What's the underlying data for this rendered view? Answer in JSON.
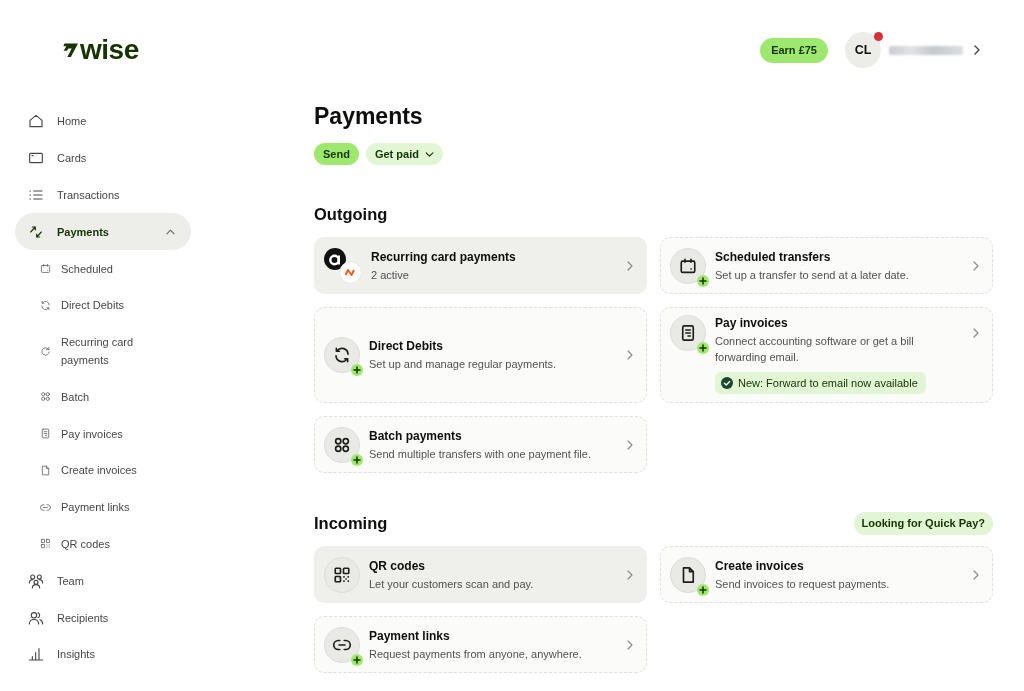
{
  "header": {
    "logo": "wise",
    "earn_button": "Earn £75",
    "account": {
      "initials": "CL",
      "notification": true
    }
  },
  "sidebar": {
    "items": [
      {
        "label": "Home",
        "selected": false
      },
      {
        "label": "Cards",
        "selected": false
      },
      {
        "label": "Transactions",
        "selected": false
      },
      {
        "label": "Payments",
        "selected": true,
        "expanded": true,
        "children": [
          {
            "label": "Scheduled",
            "selected": false
          },
          {
            "label": "Direct Debits",
            "selected": false
          },
          {
            "label": "Recurring card payments",
            "selected": false
          },
          {
            "label": "Batch",
            "selected": false
          },
          {
            "label": "Pay invoices",
            "selected": false
          },
          {
            "label": "Create invoices",
            "selected": false
          },
          {
            "label": "Payment links",
            "selected": false
          },
          {
            "label": "QR codes",
            "selected": false
          }
        ]
      },
      {
        "label": "Team",
        "selected": false
      },
      {
        "label": "Recipients",
        "selected": false
      },
      {
        "label": "Insights",
        "selected": false
      }
    ]
  },
  "page": {
    "title": "Payments",
    "tabs": [
      {
        "label": "Send",
        "selected": true,
        "kind": "button"
      },
      {
        "label": "Get paid",
        "selected": false,
        "kind": "dropdown"
      }
    ]
  },
  "sections": [
    {
      "title": "Outgoing",
      "cards": [
        {
          "kind": "active",
          "title": "Recurring card payments",
          "description": "2 active"
        },
        {
          "kind": "available",
          "title": "Direct Debits",
          "description": "Set up and manage regular payments."
        },
        {
          "kind": "available",
          "title": "Batch payments",
          "description": "Send multiple transfers with one payment file."
        },
        {
          "kind": "available",
          "title": "Scheduled transfers",
          "description": "Set up a transfer to send at a later date."
        },
        {
          "kind": "available",
          "title": "Pay invoices",
          "description": "Connect accounting software or get a bill forwarding email.",
          "notice": "New: Forward to email now available"
        }
      ]
    },
    {
      "title": "Incoming",
      "action": "Looking for Quick Pay?",
      "cards": [
        {
          "kind": "active",
          "title": "QR codes",
          "description": "Let your customers scan and pay."
        },
        {
          "kind": "available",
          "title": "Payment links",
          "description": "Request payments from anyone, anywhere."
        },
        {
          "kind": "available",
          "title": "Create invoices",
          "description": "Send invoices to request payments."
        }
      ]
    }
  ]
}
